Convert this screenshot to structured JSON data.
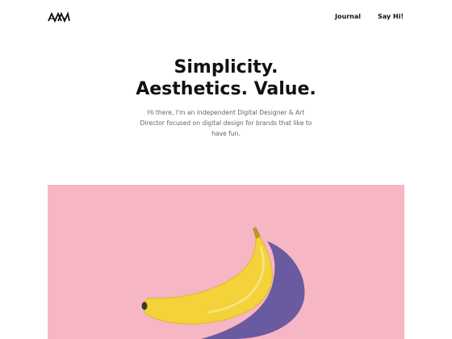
{
  "brand": {
    "logo_icon": "mountain-peaks-logo-icon"
  },
  "nav": {
    "items": [
      {
        "label": "Journal"
      },
      {
        "label": "Say Hi!"
      }
    ]
  },
  "hero": {
    "title_line1": "Simplicity.",
    "title_line2": "Aesthetics. Value.",
    "subtitle": "Hi there, I'm an independent Digital Designer & Art Director focused on digital design for brands that like to have fun.",
    "image": {
      "background_color": "#f7b6c3",
      "subject_icon": "banana-icon"
    }
  },
  "colors": {
    "text": "#111111",
    "muted": "#666666",
    "pink": "#f7b6c3",
    "banana": "#f3d23a",
    "shadow": "#6a5aa0"
  }
}
